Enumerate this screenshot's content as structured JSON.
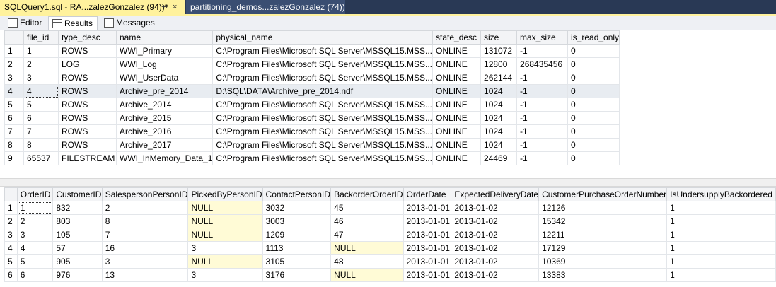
{
  "doc_tabs": [
    {
      "label": "SQLQuery1.sql - RA...zalezGonzalez (94))*",
      "pin": "⇸",
      "close": "×"
    },
    {
      "label": "partitioning_demos...zalezGonzalez (74))"
    }
  ],
  "results_tabs": [
    {
      "label": "Editor",
      "icon": "editor-icon"
    },
    {
      "label": "Results",
      "icon": "grid-icon"
    },
    {
      "label": "Messages",
      "icon": "messages-icon"
    }
  ],
  "grid1": {
    "columns": [
      "file_id",
      "type_desc",
      "name",
      "physical_name",
      "state_desc",
      "size",
      "max_size",
      "is_read_only"
    ],
    "rows": [
      [
        "1",
        "1",
        "ROWS",
        "WWI_Primary",
        "C:\\Program Files\\Microsoft SQL Server\\MSSQL15.MSS...",
        "ONLINE",
        "131072",
        "-1",
        "0"
      ],
      [
        "2",
        "2",
        "LOG",
        "WWI_Log",
        "C:\\Program Files\\Microsoft SQL Server\\MSSQL15.MSS...",
        "ONLINE",
        "12800",
        "268435456",
        "0"
      ],
      [
        "3",
        "3",
        "ROWS",
        "WWI_UserData",
        "C:\\Program Files\\Microsoft SQL Server\\MSSQL15.MSS...",
        "ONLINE",
        "262144",
        "-1",
        "0"
      ],
      [
        "4",
        "4",
        "ROWS",
        "Archive_pre_2014",
        "D:\\SQL\\DATA\\Archive_pre_2014.ndf",
        "ONLINE",
        "1024",
        "-1",
        "0"
      ],
      [
        "5",
        "5",
        "ROWS",
        "Archive_2014",
        "C:\\Program Files\\Microsoft SQL Server\\MSSQL15.MSS...",
        "ONLINE",
        "1024",
        "-1",
        "0"
      ],
      [
        "6",
        "6",
        "ROWS",
        "Archive_2015",
        "C:\\Program Files\\Microsoft SQL Server\\MSSQL15.MSS...",
        "ONLINE",
        "1024",
        "-1",
        "0"
      ],
      [
        "7",
        "7",
        "ROWS",
        "Archive_2016",
        "C:\\Program Files\\Microsoft SQL Server\\MSSQL15.MSS...",
        "ONLINE",
        "1024",
        "-1",
        "0"
      ],
      [
        "8",
        "8",
        "ROWS",
        "Archive_2017",
        "C:\\Program Files\\Microsoft SQL Server\\MSSQL15.MSS...",
        "ONLINE",
        "1024",
        "-1",
        "0"
      ],
      [
        "9",
        "65537",
        "FILESTREAM",
        "WWI_InMemory_Data_1",
        "C:\\Program Files\\Microsoft SQL Server\\MSSQL15.MSS...",
        "ONLINE",
        "24469",
        "-1",
        "0"
      ]
    ]
  },
  "grid2": {
    "columns": [
      "OrderID",
      "CustomerID",
      "SalespersonPersonID",
      "PickedByPersonID",
      "ContactPersonID",
      "BackorderOrderID",
      "OrderDate",
      "ExpectedDeliveryDate",
      "CustomerPurchaseOrderNumber",
      "IsUndersupplyBackordered"
    ],
    "rows": [
      [
        "1",
        "1",
        "832",
        "2",
        "NULL",
        "3032",
        "45",
        "2013-01-01",
        "2013-01-02",
        "12126",
        "1"
      ],
      [
        "2",
        "2",
        "803",
        "8",
        "NULL",
        "3003",
        "46",
        "2013-01-01",
        "2013-01-02",
        "15342",
        "1"
      ],
      [
        "3",
        "3",
        "105",
        "7",
        "NULL",
        "1209",
        "47",
        "2013-01-01",
        "2013-01-02",
        "12211",
        "1"
      ],
      [
        "4",
        "4",
        "57",
        "16",
        "3",
        "1113",
        "NULL",
        "2013-01-01",
        "2013-01-02",
        "17129",
        "1"
      ],
      [
        "5",
        "5",
        "905",
        "3",
        "NULL",
        "3105",
        "48",
        "2013-01-01",
        "2013-01-02",
        "10369",
        "1"
      ],
      [
        "6",
        "6",
        "976",
        "13",
        "3",
        "3176",
        "NULL",
        "2013-01-01",
        "2013-01-02",
        "13383",
        "1"
      ]
    ]
  },
  "colors": {
    "active_tab": "#fff29d",
    "tab_bar": "#293955",
    "null_cell": "#fffbd6",
    "selected_row": "#e8ecf1"
  }
}
